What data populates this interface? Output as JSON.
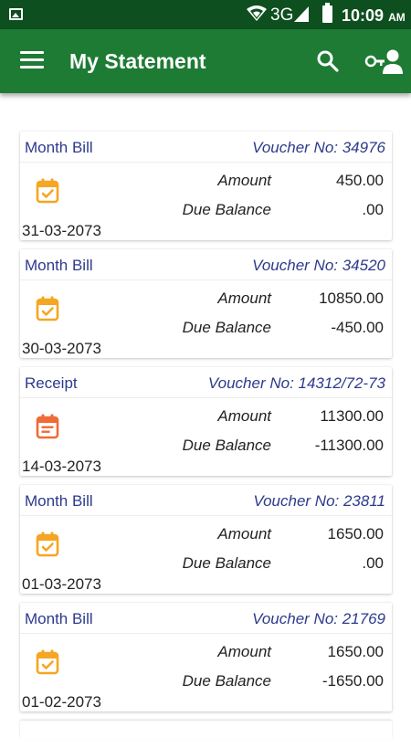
{
  "status_bar": {
    "network": "3G",
    "time": "10:09",
    "ampm": "AM"
  },
  "app_bar": {
    "title": "My Statement",
    "color": "#1e7b34"
  },
  "labels": {
    "amount": "Amount",
    "due_balance": "Due Balance"
  },
  "statements": [
    {
      "type": "Month Bill",
      "voucher": "Voucher No: 34976",
      "amount": "450.00",
      "due_balance": ".00",
      "date": "31-03-2073",
      "icon": "calendar-check-icon"
    },
    {
      "type": "Month Bill",
      "voucher": "Voucher No: 34520",
      "amount": "10850.00",
      "due_balance": "-450.00",
      "date": "30-03-2073",
      "icon": "calendar-check-icon"
    },
    {
      "type": "Receipt",
      "voucher": "Voucher No: 14312/72-73",
      "amount": "11300.00",
      "due_balance": "-11300.00",
      "date": "14-03-2073",
      "icon": "calendar-note-icon"
    },
    {
      "type": "Month Bill",
      "voucher": "Voucher No: 23811",
      "amount": "1650.00",
      "due_balance": ".00",
      "date": "01-03-2073",
      "icon": "calendar-check-icon"
    },
    {
      "type": "Month Bill",
      "voucher": "Voucher No: 21769",
      "amount": "1650.00",
      "due_balance": "-1650.00",
      "date": "01-02-2073",
      "icon": "calendar-check-icon"
    }
  ],
  "colors": {
    "status_bar": "#0e4f1f",
    "header_text": "#2d3a8c",
    "bill_icon": "#f5a623",
    "receipt_icon": "#f06a35"
  }
}
